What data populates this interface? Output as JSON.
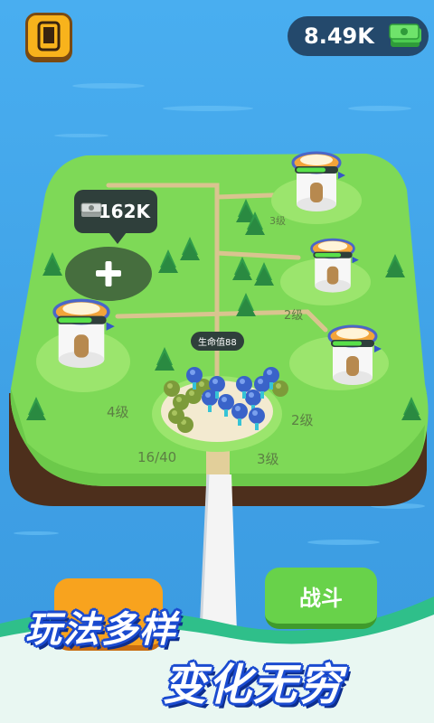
{
  "hud": {
    "phone_icon": "phone-icon",
    "cash": "8.49K",
    "cash_icon": "cash-stack-icon"
  },
  "island": {
    "build_slot": {
      "cost": "162K",
      "icon": "plus-icon"
    },
    "towers": [
      {
        "level_label": "3级"
      },
      {
        "level_label": "2级"
      },
      {
        "level_label": "2级"
      },
      {
        "level_label": "4级"
      }
    ],
    "army": {
      "hp_label": "生命值88",
      "count": "16/40",
      "level_label": "3级"
    }
  },
  "buttons": {
    "fight": "战斗"
  },
  "slogan": {
    "line1": "玩法多样",
    "line2": "变化无穷"
  },
  "colors": {
    "sea": "#44a8ec",
    "grass": "#7ed957",
    "cliff": "#4d2f1c",
    "orange": "#f8a31e",
    "green_button": "#68d24a",
    "slogan_outline": "#1b4bd0"
  }
}
